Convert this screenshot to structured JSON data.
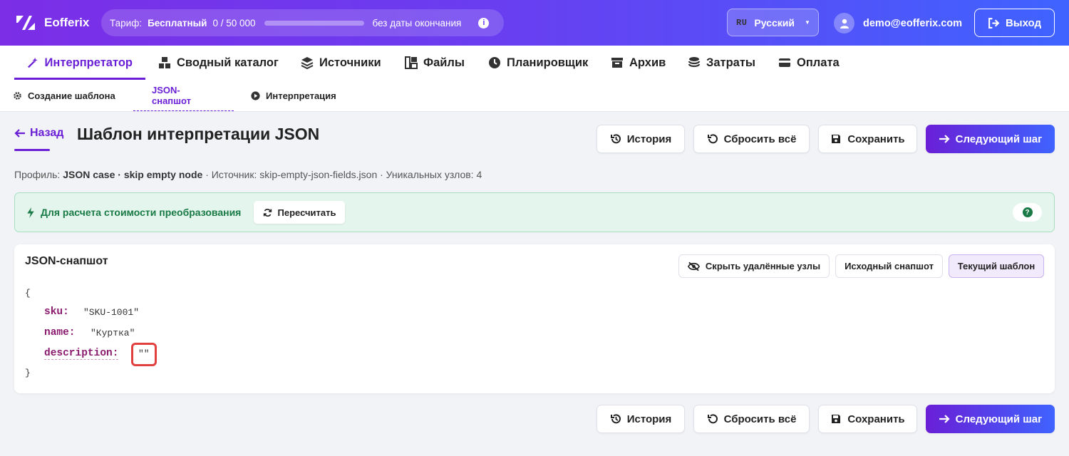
{
  "app": {
    "name": "Eofferix"
  },
  "tariff": {
    "label": "Тариф:",
    "plan": "Бесплатный",
    "usage": "0 / 50 000",
    "progress_fraction": 0.0,
    "expiry": "без даты окончания"
  },
  "language": {
    "code": "RU",
    "name": "Русский"
  },
  "user": {
    "email": "demo@eofferix.com"
  },
  "logout_label": "Выход",
  "main_nav": [
    {
      "label": "Интерпретатор",
      "icon": "magic-wand-icon",
      "active": true
    },
    {
      "label": "Сводный каталог",
      "icon": "boxes-icon"
    },
    {
      "label": "Источники",
      "icon": "layers-icon"
    },
    {
      "label": "Файлы",
      "icon": "files-icon"
    },
    {
      "label": "Планировщик",
      "icon": "clock-icon"
    },
    {
      "label": "Архив",
      "icon": "archive-icon"
    },
    {
      "label": "Затраты",
      "icon": "coins-icon"
    },
    {
      "label": "Оплата",
      "icon": "credit-card-icon"
    }
  ],
  "sub_nav": [
    {
      "label": "Создание шаблона",
      "icon": "gear-icon"
    },
    {
      "label": "JSON-снапшот",
      "active": true
    },
    {
      "label": "Интерпретация",
      "icon": "play-icon"
    }
  ],
  "page": {
    "back_label": "Назад",
    "title": "Шаблон интерпретации JSON"
  },
  "toolbar": {
    "history": "История",
    "reset": "Сбросить всё",
    "save": "Сохранить",
    "next": "Следующий шаг"
  },
  "meta": {
    "profile_label": "Профиль:",
    "profile_value": "JSON case · skip empty node",
    "rest": "· Источник: skip-empty-json-fields.json · Уникальных узлов: 4"
  },
  "alert": {
    "text": "Для расчета стоимости преобразования",
    "recalc": "Пересчитать",
    "help": "?"
  },
  "snapshot": {
    "title": "JSON-снапшот",
    "hide_deleted": "Скрыть удалённые узлы",
    "original": "Исходный снапшот",
    "current": "Текущий шаблон",
    "open_brace": "{",
    "close_brace": "}",
    "fields": [
      {
        "key": "sku:",
        "value": "\"SKU-1001\""
      },
      {
        "key": "name:",
        "value": "\"Куртка\""
      },
      {
        "key": "description:",
        "value": "\"\""
      }
    ]
  },
  "colors": {
    "accent": "#6a1fd6",
    "accent2": "#3f63ff",
    "success_bg": "#e3f5ec",
    "success_text": "#197a45",
    "highlight": "#e0413f"
  }
}
